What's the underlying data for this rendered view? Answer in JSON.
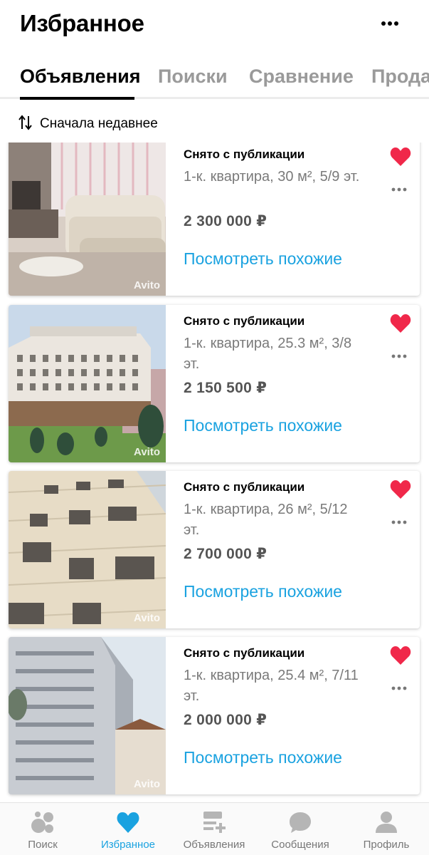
{
  "header": {
    "title": "Избранное",
    "more_icon": "more-horizontal-icon"
  },
  "tabs": [
    {
      "label": "Объявления",
      "active": true
    },
    {
      "label": "Поиски",
      "active": false
    },
    {
      "label": "Сравнение",
      "active": false
    },
    {
      "label": "Прода",
      "active": false
    }
  ],
  "sort": {
    "icon": "sort-arrows-icon",
    "label": "Сначала недавнее"
  },
  "listings": [
    {
      "status": "Снято с публикации",
      "description": "1-к. квартира, 30 м², 5/9 эт.",
      "price": "2 300 000 ₽",
      "similar_label": "Посмотреть похожие",
      "watermark": "Avito",
      "favorited": true
    },
    {
      "status": "Снято с публикации",
      "description": "1-к. квартира, 25.3 м², 3/8 эт.",
      "price": "2 150 500 ₽",
      "similar_label": "Посмотреть похожие",
      "watermark": "Avito",
      "favorited": true
    },
    {
      "status": "Снято с публикации",
      "description": "1-к. квартира, 26 м², 5/12 эт.",
      "price": "2 700 000 ₽",
      "similar_label": "Посмотреть похожие",
      "watermark": "Avito",
      "favorited": true
    },
    {
      "status": "Снято с публикации",
      "description": "1-к. квартира, 25.4 м², 7/11 эт.",
      "price": "2 000 000 ₽",
      "similar_label": "Посмотреть похожие",
      "watermark": "Avito",
      "favorited": true
    }
  ],
  "bottom_nav": [
    {
      "label": "Поиск",
      "icon": "search-bubbles-icon",
      "active": false
    },
    {
      "label": "Избранное",
      "icon": "heart-icon",
      "active": true
    },
    {
      "label": "Объявления",
      "icon": "listings-add-icon",
      "active": false
    },
    {
      "label": "Сообщения",
      "icon": "chat-bubble-icon",
      "active": false
    },
    {
      "label": "Профиль",
      "icon": "profile-icon",
      "active": false
    }
  ],
  "colors": {
    "accent": "#1aa2e0",
    "heart": "#f0284a",
    "muted_text": "#7a7a7a",
    "inactive_tab": "#9a9a9a"
  }
}
